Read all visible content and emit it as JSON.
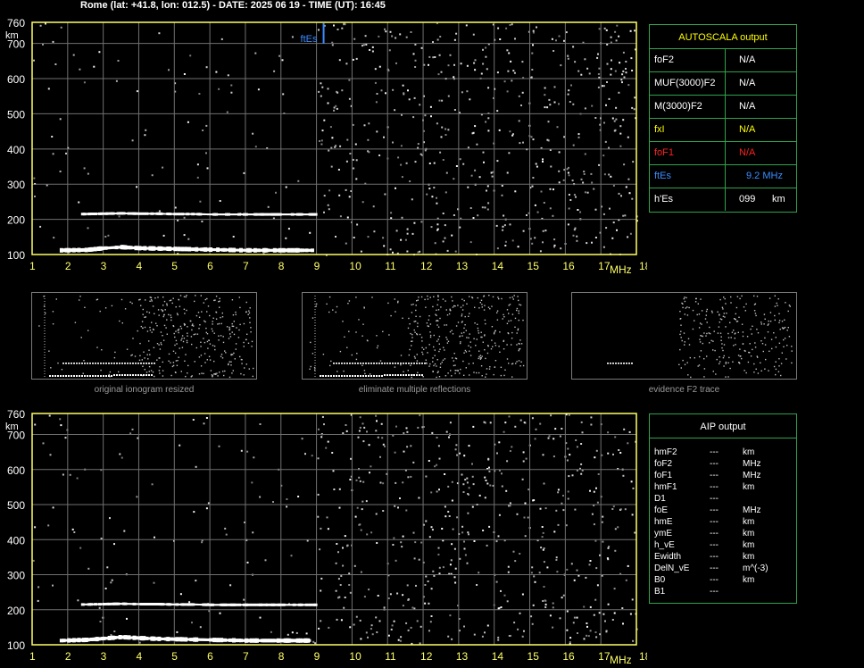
{
  "header": {
    "title": "Rome (lat: +41.8, lon: 012.5) - DATE: 2025 06 19 - TIME (UT): 16:45"
  },
  "colors": {
    "axis": "#ffff66",
    "grid": "#707070",
    "border": "#2fa24a",
    "white_label": "#ffffff",
    "yellow_label": "#ffff00",
    "red_label": "#ff2020",
    "blue_label": "#3a8cff"
  },
  "autoscala": {
    "title": "AUTOSCALA output",
    "rows": [
      {
        "label": "foF2",
        "value": "N/A",
        "unit": "",
        "color": "#ffffff"
      },
      {
        "label": "MUF(3000)F2",
        "value": "N/A",
        "unit": "",
        "color": "#ffffff"
      },
      {
        "label": "M(3000)F2",
        "value": "N/A",
        "unit": "",
        "color": "#ffffff"
      },
      {
        "label": "fxI",
        "value": "N/A",
        "unit": "",
        "color": "#ffff00"
      },
      {
        "label": "foF1",
        "value": "N/A",
        "unit": "",
        "color": "#ff2020"
      },
      {
        "label": "ftEs",
        "value": "9.2 MHz",
        "unit": "",
        "color": "#3a8cff"
      },
      {
        "label": "h'Es",
        "value": "099",
        "unit": "km",
        "color": "#ffffff"
      }
    ]
  },
  "aip": {
    "title": "AIP output",
    "rows": [
      {
        "label": "hmF2",
        "value": "---",
        "unit": "km"
      },
      {
        "label": "foF2",
        "value": "---",
        "unit": "MHz"
      },
      {
        "label": "foF1",
        "value": "---",
        "unit": "MHz"
      },
      {
        "label": "hmF1",
        "value": "---",
        "unit": "km"
      },
      {
        "label": "D1",
        "value": "---",
        "unit": ""
      },
      {
        "label": "foE",
        "value": "---",
        "unit": "MHz"
      },
      {
        "label": "hmE",
        "value": "---",
        "unit": "km"
      },
      {
        "label": "ymE",
        "value": "---",
        "unit": "km"
      },
      {
        "label": "h_vE",
        "value": "---",
        "unit": "km"
      },
      {
        "label": "Ewidth",
        "value": "---",
        "unit": "km"
      },
      {
        "label": "DelN_vE",
        "value": "---",
        "unit": "m^(-3)"
      },
      {
        "label": "B0",
        "value": "---",
        "unit": "km"
      },
      {
        "label": "B1",
        "value": "---",
        "unit": ""
      }
    ]
  },
  "thumbnails": {
    "captions": [
      "original ionogram resized",
      "eliminate multiple reflections",
      "evidence F2 trace"
    ]
  },
  "chart_data": [
    {
      "type": "scatter",
      "title": "",
      "xlabel": "MHz",
      "ylabel": "km",
      "xlim": [
        1,
        18
      ],
      "ylim": [
        100,
        760
      ],
      "x_ticks": [
        "1",
        "2",
        "3",
        "4",
        "5",
        "6",
        "7",
        "8",
        "9",
        "10",
        "11",
        "12",
        "13",
        "14",
        "15",
        "16",
        "17",
        "18"
      ],
      "y_ticks": [
        "100",
        "200",
        "300",
        "400",
        "500",
        "600",
        "700",
        "760"
      ],
      "grid": true,
      "ftEs_marker": {
        "label": "ftEs",
        "x": 9.2
      },
      "series": [
        {
          "name": "",
          "points": [
            [
              1.8,
              112
            ],
            [
              2.5,
              113
            ],
            [
              3.0,
              118
            ],
            [
              3.5,
              121
            ],
            [
              4.0,
              118
            ],
            [
              4.5,
              117
            ],
            [
              5.0,
              116
            ],
            [
              5.5,
              115
            ],
            [
              6.0,
              114
            ],
            [
              6.5,
              113
            ],
            [
              7.0,
              112
            ],
            [
              7.5,
              112
            ],
            [
              8.0,
              112
            ],
            [
              8.5,
              112
            ],
            [
              8.9,
              112
            ]
          ]
        },
        {
          "name": "",
          "points": [
            [
              2.4,
              215
            ],
            [
              3.0,
              216
            ],
            [
              3.5,
              217
            ],
            [
              4.0,
              216
            ],
            [
              4.5,
              216
            ],
            [
              5.0,
              215
            ],
            [
              5.5,
              215
            ],
            [
              6.0,
              214
            ],
            [
              6.5,
              214
            ],
            [
              7.0,
              214
            ],
            [
              7.5,
              214
            ],
            [
              8.0,
              214
            ],
            [
              8.5,
              214
            ],
            [
              9.0,
              214
            ]
          ]
        }
      ]
    },
    {
      "type": "scatter",
      "title": "",
      "xlabel": "MHz",
      "ylabel": "km",
      "xlim": [
        1,
        18
      ],
      "ylim": [
        100,
        760
      ],
      "x_ticks": [
        "1",
        "2",
        "3",
        "4",
        "5",
        "6",
        "7",
        "8",
        "9",
        "10",
        "11",
        "12",
        "13",
        "14",
        "15",
        "16",
        "17",
        "18"
      ],
      "y_ticks": [
        "100",
        "200",
        "300",
        "400",
        "500",
        "600",
        "700",
        "760"
      ],
      "grid": true,
      "series": [
        {
          "name": "",
          "points": [
            [
              1.8,
              112
            ],
            [
              2.5,
              114
            ],
            [
              3.0,
              118
            ],
            [
              3.5,
              122
            ],
            [
              4.0,
              119
            ],
            [
              4.5,
              117
            ],
            [
              5.0,
              116
            ],
            [
              5.5,
              115
            ],
            [
              6.0,
              114
            ],
            [
              6.5,
              113
            ],
            [
              7.0,
              112
            ],
            [
              7.5,
              112
            ],
            [
              8.0,
              112
            ],
            [
              8.5,
              112
            ],
            [
              8.8,
              112
            ]
          ]
        },
        {
          "name": "",
          "points": [
            [
              2.4,
              215
            ],
            [
              3.0,
              216
            ],
            [
              3.5,
              217
            ],
            [
              4.0,
              216
            ],
            [
              4.5,
              216
            ],
            [
              5.0,
              215
            ],
            [
              5.5,
              215
            ],
            [
              6.0,
              214
            ],
            [
              6.5,
              214
            ],
            [
              7.0,
              214
            ],
            [
              7.5,
              214
            ],
            [
              8.0,
              214
            ],
            [
              8.5,
              214
            ],
            [
              9.0,
              214
            ]
          ]
        }
      ]
    }
  ]
}
